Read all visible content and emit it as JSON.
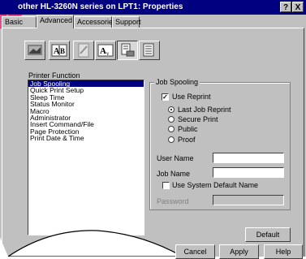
{
  "window": {
    "title": "other HL-3260N series on LPT1: Properties",
    "help_button": "?",
    "close_button": "X"
  },
  "tabs": [
    {
      "label": "Basic"
    },
    {
      "label": "Advanced"
    },
    {
      "label": "Accessories"
    },
    {
      "label": "Support"
    }
  ],
  "toolbar": {
    "icons": [
      "graphics-icon",
      "text-ab-icon",
      "watermark-icon",
      "font-substitution-icon",
      "device-options-icon",
      "overlay-icon"
    ]
  },
  "printer_function": {
    "label": "Printer Function",
    "items": [
      "Job Spooling",
      "Quick Print Setup",
      "Sleep Time",
      "Status Monitor",
      "Macro",
      "Administrator",
      "Insert Command/File",
      "Page Protection",
      "Print Date & Time"
    ],
    "selected_index": 0
  },
  "job_spooling": {
    "group_title": "Job Spooling",
    "use_reprint_label": "Use Reprint",
    "use_reprint_checked": true,
    "options": [
      "Last Job Reprint",
      "Secure Print",
      "Public",
      "Proof"
    ],
    "selected_option": 0,
    "user_name_label": "User Name",
    "user_name_value": "",
    "job_name_label": "Job Name",
    "job_name_value": "",
    "use_system_default_label": "Use System Default Name",
    "password_label": "Password",
    "password_value": ""
  },
  "buttons": {
    "default": "Default",
    "cancel": "Cancel",
    "apply": "Apply",
    "help": "Help"
  }
}
